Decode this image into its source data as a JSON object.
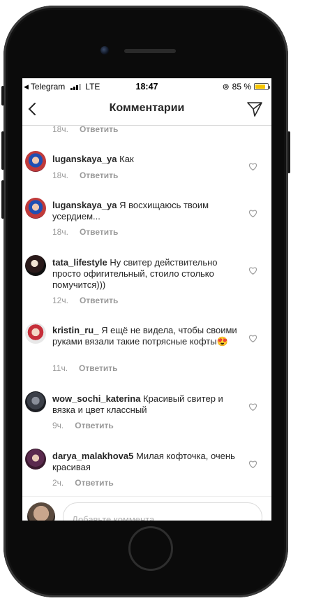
{
  "status": {
    "app": "Telegram",
    "network": "LTE",
    "time": "18:47",
    "battery": "85 %"
  },
  "header": {
    "title": "Комментарии"
  },
  "top_meta": {
    "time": "18ч.",
    "reply": "Ответить"
  },
  "comments": [
    {
      "user": "luganskaya_ya",
      "text": "Как",
      "time": "18ч.",
      "reply": "Ответить"
    },
    {
      "user": "luganskaya_ya",
      "text": "Я восхищаюсь твоим усердием...",
      "time": "18ч.",
      "reply": "Ответить"
    },
    {
      "user": "tata_lifestyle",
      "text": "Ну свитер действительно просто офигительный, стоило столько помучится)))",
      "time": "12ч.",
      "reply": "Ответить"
    },
    {
      "user": "kristin_ru_",
      "text": "Я ещё не видела, чтобы своими руками вязали такие потрясные кофты😍",
      "time": "11ч.",
      "reply": "Ответить"
    },
    {
      "user": "wow_sochi_katerina",
      "text": "Красивый свитер и вязка и цвет классный",
      "time": "9ч.",
      "reply": "Ответить"
    },
    {
      "user": "darya_malakhova5",
      "text": "Милая кофточка, очень красивая",
      "time": "2ч.",
      "reply": "Ответить"
    }
  ],
  "composer": {
    "placeholder": "Добавьте коммента..."
  },
  "colors": {
    "battery": "#f5c400",
    "meta": "#999999",
    "text": "#262626"
  }
}
